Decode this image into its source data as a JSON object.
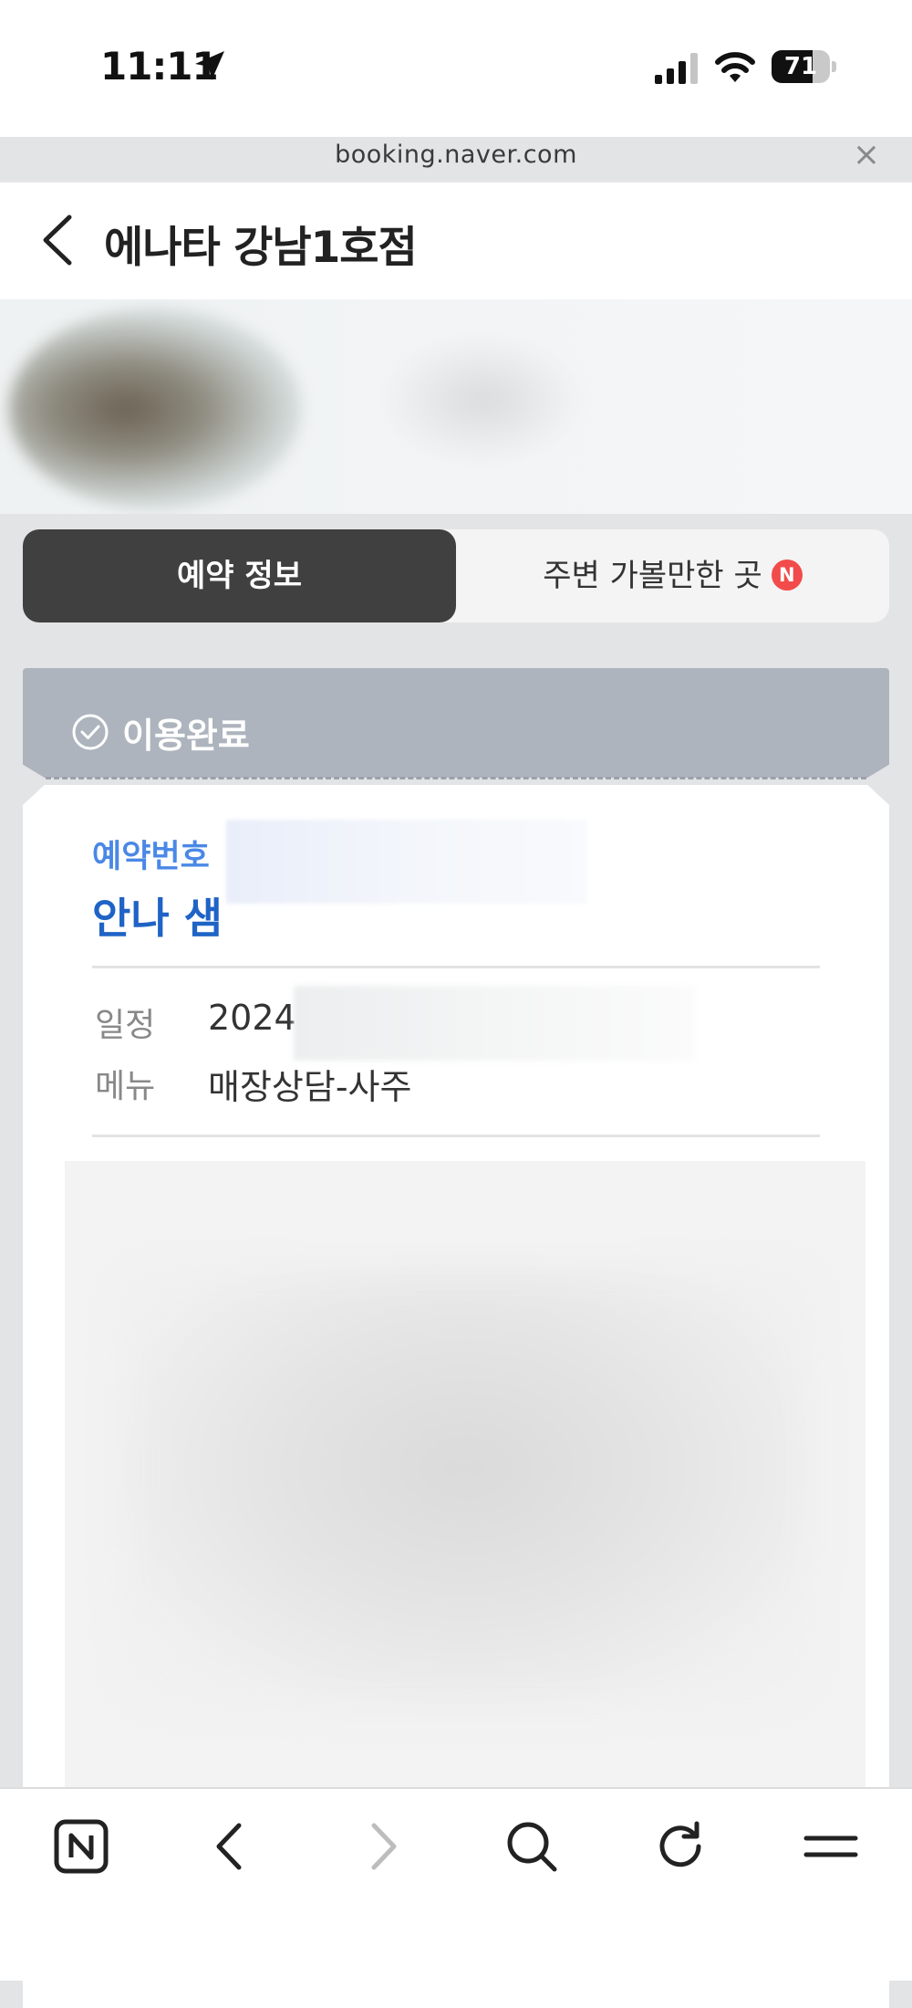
{
  "status_bar": {
    "time": "11:11",
    "battery": "71",
    "battery_level": 0.71,
    "icons": [
      "location-arrow-icon",
      "cellular-signal-icon",
      "wifi-icon",
      "battery-icon"
    ]
  },
  "browser": {
    "url": "booking.naver.com",
    "close_label": "×"
  },
  "header": {
    "title": "에나타 강남1호점"
  },
  "tabs": {
    "active_label": "예약 정보",
    "inactive_label": "주변 가볼만한 곳",
    "badge": "N"
  },
  "status": {
    "text": "이용완료"
  },
  "booking": {
    "number_label": "예약번호",
    "name": "안나 샘",
    "rows": [
      {
        "label": "일정",
        "value": "2024"
      },
      {
        "label": "메뉴",
        "value": "매장상담-사주"
      }
    ]
  },
  "colors": {
    "accent_blue": "#4a88e6",
    "name_blue": "#1f63c6",
    "tab_active_bg": "#404040",
    "status_banner": "#adb4bd",
    "badge_red": "#f24b4b"
  },
  "bottom_nav": {
    "icons": [
      "naver-home-icon",
      "back-arrow-icon",
      "forward-arrow-icon",
      "search-icon",
      "refresh-icon",
      "menu-icon"
    ]
  }
}
